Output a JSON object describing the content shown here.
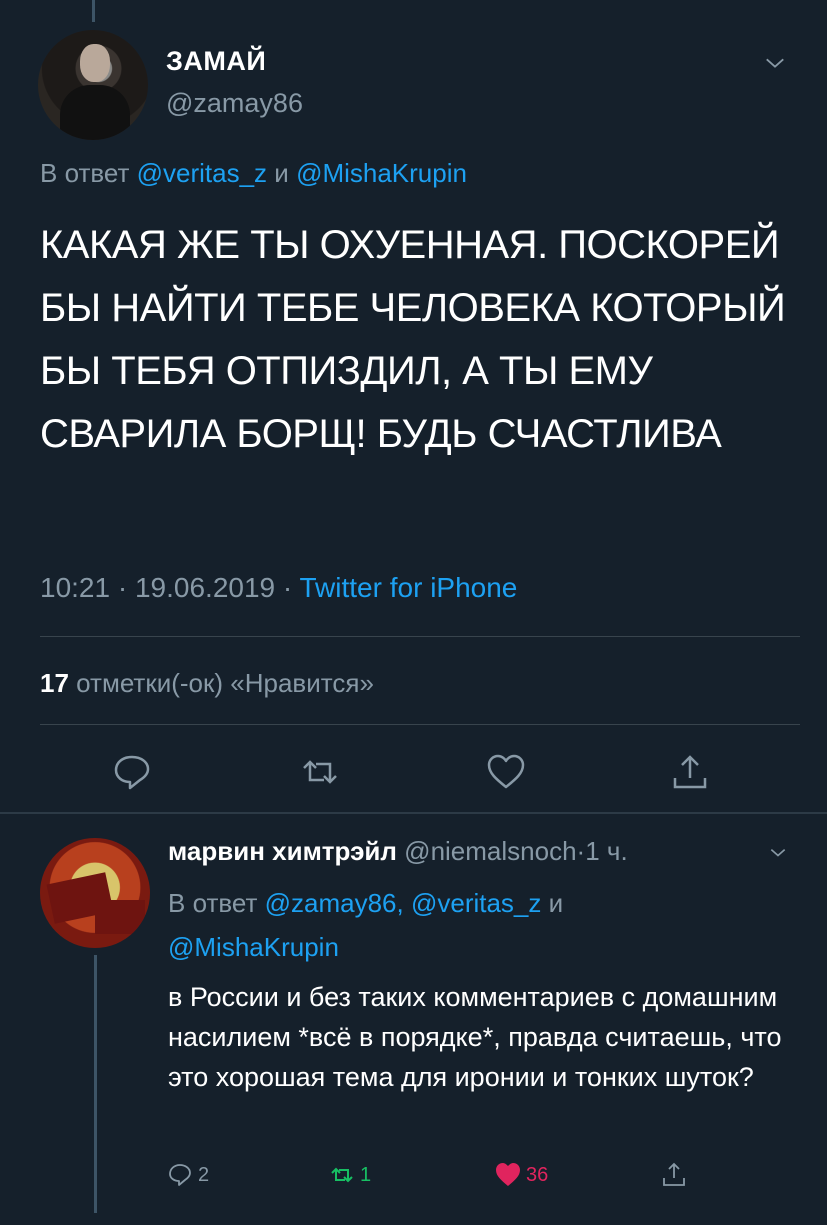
{
  "tweet": {
    "display_name": "ЗАМАЙ",
    "handle": "@zamay86",
    "reply_prefix": "В ответ",
    "reply_user1": "@veritas_z",
    "reply_and": "и",
    "reply_user2": "@MishaKrupin",
    "text": "КАКАЯ ЖЕ ТЫ ОХУЕННАЯ. ПОСКОРЕЙ БЫ НАЙТИ ТЕБЕ ЧЕЛОВЕКА КОТОРЫЙ БЫ ТЕБЯ ОТПИЗДИЛ, А ТЫ ЕМУ СВАРИЛА БОРЩ! БУДЬ СЧАСТЛИВА",
    "time": "10:21",
    "date": "19.06.2019",
    "meta_sep": "·",
    "source": "Twitter for iPhone",
    "likes_count": "17",
    "likes_label": "отметки(-ок) «Нравится»"
  },
  "reply": {
    "display_name": "марвин химтрэйл",
    "handle": "@niemalsnoch",
    "age": "1 ч.",
    "reply_prefix": "В ответ",
    "reply_users": "@zamay86, @veritas_z",
    "reply_and": "и",
    "reply_user3": "@MishaKrupin",
    "text": "в России и без таких комментариев с домашним насилием *всё в порядке*, правда считаешь, что это хорошая тема для иронии и тонких шуток?",
    "reply_count": "2",
    "retweet_count": "1",
    "like_count": "36"
  },
  "icons": {
    "reply": "reply-icon",
    "retweet": "retweet-icon",
    "like": "heart-icon",
    "share": "share-icon",
    "more": "chevron-down-icon"
  },
  "colors": {
    "background": "#15202b",
    "link": "#1da1f2",
    "muted": "#8899a6",
    "retweet_green": "#17bf63",
    "like_red": "#e0245e"
  }
}
